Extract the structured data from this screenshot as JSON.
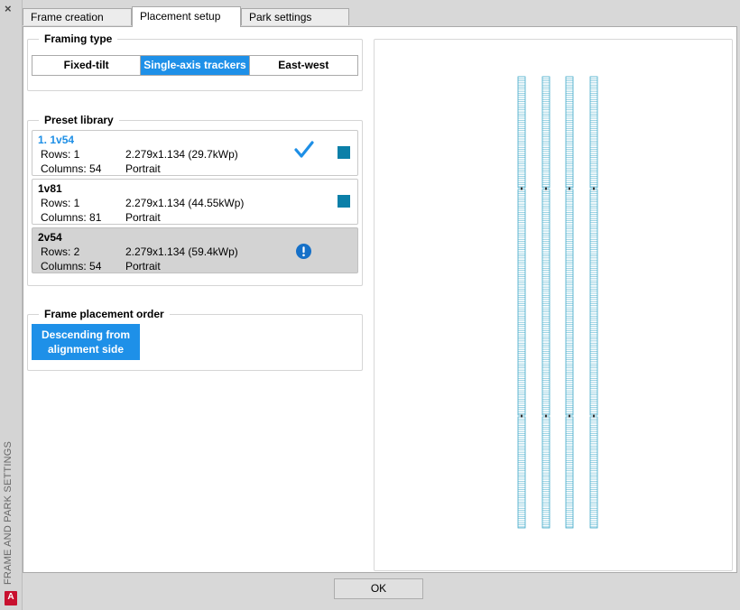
{
  "sidebar": {
    "close_glyph": "×",
    "label": "FRAME AND PARK SETTINGS",
    "logo_letter": "A"
  },
  "tabs": [
    {
      "label": "Frame creation",
      "active": false
    },
    {
      "label": "Placement setup",
      "active": true
    },
    {
      "label": "Park settings",
      "active": false
    }
  ],
  "framing_type": {
    "title": "Framing type",
    "options": [
      "Fixed-tilt",
      "Single-axis trackers",
      "East-west"
    ],
    "selected": "Single-axis trackers"
  },
  "preset_library": {
    "title": "Preset library",
    "items": [
      {
        "name": "1. 1v54",
        "rows": "Rows: 1",
        "columns": "Columns: 54",
        "dims": "2.279x1.134 (29.7kWp)",
        "orientation": "Portrait",
        "status_icon": "checkmark-icon",
        "color": "#0b7fa8"
      },
      {
        "name": "1v81",
        "rows": "Rows: 1",
        "columns": "Columns: 81",
        "dims": "2.279x1.134 (44.55kWp)",
        "orientation": "Portrait",
        "color": "#0b7fa8"
      },
      {
        "name": "2v54",
        "rows": "Rows: 2",
        "columns": "Columns: 54",
        "dims": "2.279x1.134 (59.4kWp)",
        "orientation": "Portrait",
        "status_icon": "warning-icon"
      }
    ]
  },
  "placement_order": {
    "title": "Frame placement order",
    "button_label": "Descending from alignment side"
  },
  "footer": {
    "ok_label": "OK"
  },
  "colors": {
    "accent": "#1e90e8",
    "preset_swatch": "#0b7fa8",
    "tracker_stroke": "#3fa9c9"
  }
}
